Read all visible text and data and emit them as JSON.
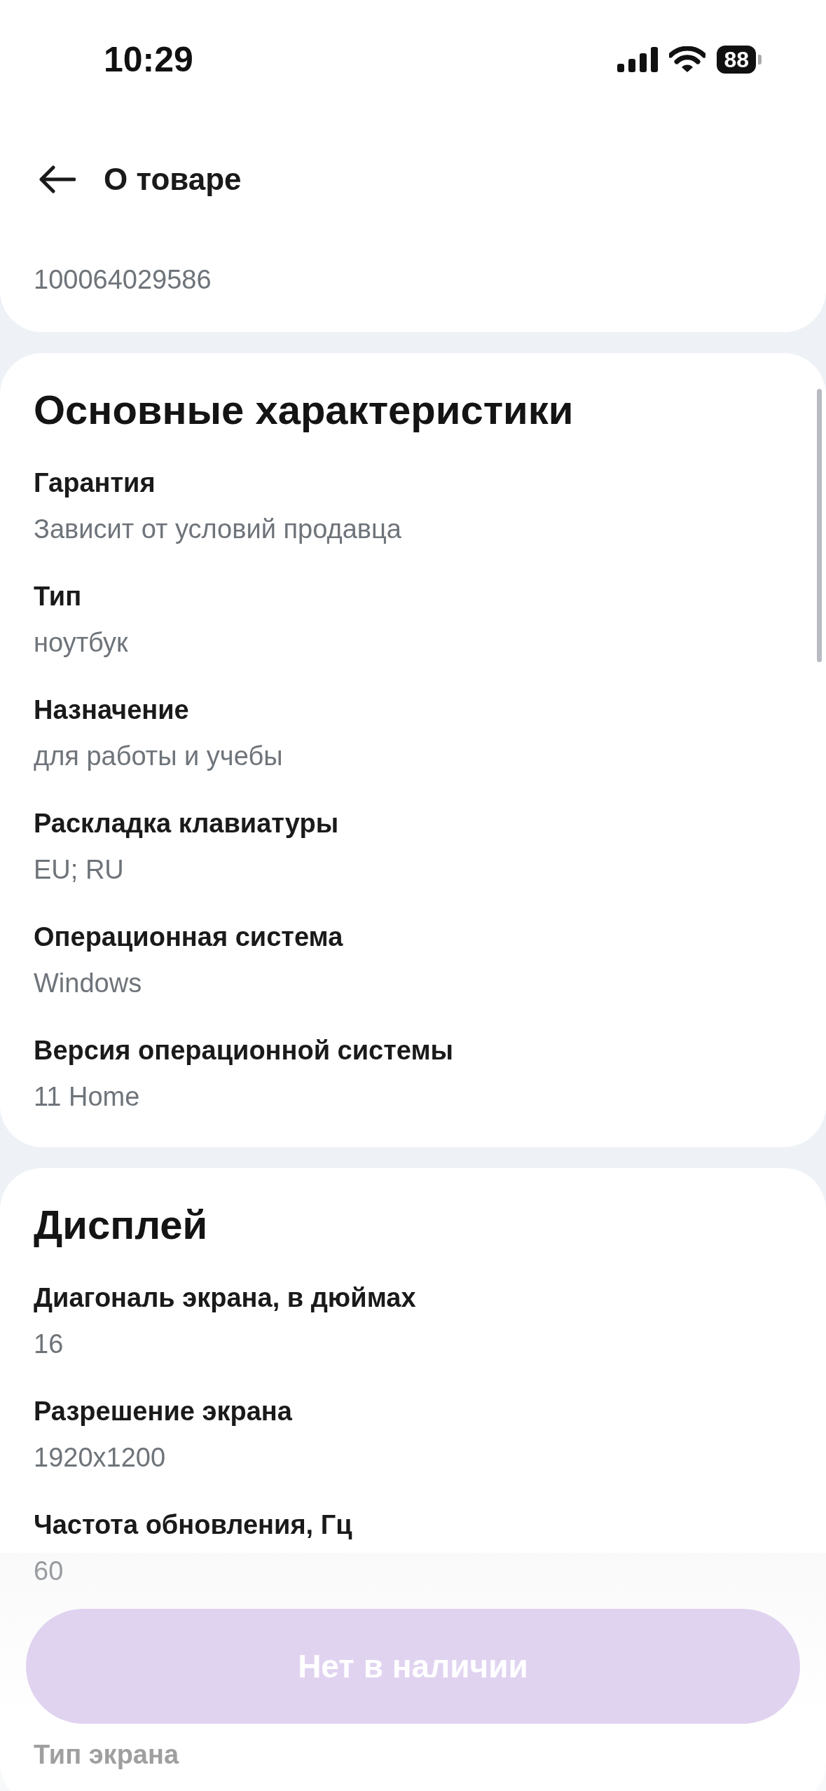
{
  "status_bar": {
    "time": "10:29",
    "battery": "88"
  },
  "header": {
    "title": "О товаре"
  },
  "product_code": {
    "value": "100064029586"
  },
  "sections": [
    {
      "title": "Основные характеристики",
      "items": [
        {
          "label": "Гарантия",
          "value": "Зависит от условий продавца"
        },
        {
          "label": "Тип",
          "value": "ноутбук"
        },
        {
          "label": "Назначение",
          "value": "для работы и учебы"
        },
        {
          "label": "Раскладка клавиатуры",
          "value": "EU; RU"
        },
        {
          "label": "Операционная система",
          "value": "Windows"
        },
        {
          "label": "Версия операционной системы",
          "value": "11 Home"
        }
      ]
    },
    {
      "title": "Дисплей",
      "items": [
        {
          "label": "Диагональ экрана, в дюймах",
          "value": "16"
        },
        {
          "label": "Разрешение экрана",
          "value": "1920x1200"
        },
        {
          "label": "Частота обновления, Гц",
          "value": "60"
        }
      ],
      "faded_label": "Тип экрана"
    }
  ],
  "action_button": {
    "label": "Нет в наличии",
    "disabled": true
  }
}
